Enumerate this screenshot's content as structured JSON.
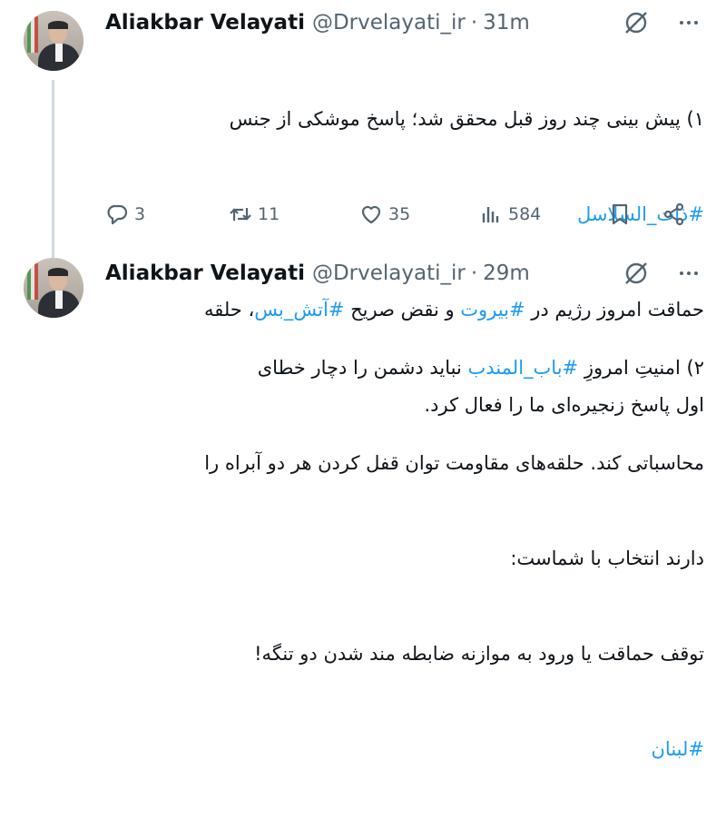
{
  "tweets": [
    {
      "author_name": "Aliakbar Velayati",
      "handle": "@Drvelayati_ir",
      "separator": "·",
      "time": "31m",
      "text": {
        "line1": "۱) پیش بینی چند روز قبل محقق شد؛ پاسخ موشکی از جنس",
        "hashtag1": "#ذات_السلاسل",
        "line3_a": "حماقت امروز رژیم در ",
        "hashtag2": "#بیروت",
        "line3_b": " و نقض صریح ",
        "hashtag3": "#آتش_بس",
        "line3_c": "، حلقه",
        "line4": "اول پاسخ زنجیره‌ای ما را فعال کرد."
      },
      "actions": {
        "replies": "3",
        "reposts": "11",
        "likes": "35",
        "views": "584"
      }
    },
    {
      "author_name": "Aliakbar Velayati",
      "handle": "@Drvelayati_ir",
      "separator": "·",
      "time": "29m",
      "text": {
        "line1_a": "۲) امنیتِ امروزِ ",
        "hashtag1": "#باب_المندب",
        "line1_b": " نباید دشمن را دچار خطای",
        "line2": "محاسباتی کند. حلقه‌های مقاومت توان قفل کردن هر دو آبراه را",
        "line3": "دارند انتخاب با شماست:",
        "line4": "توقف حماقت یا ورود به موازنه ضابطه مند شدن دو تنگه!",
        "hashtag2": "#لبنان"
      }
    }
  ],
  "icons": {
    "reply": "reply-icon",
    "repost": "repost-icon",
    "like": "heart-icon",
    "views": "views-chart-icon",
    "bookmark": "bookmark-icon",
    "share": "share-icon",
    "grok": "grok-icon",
    "more": "more-dots-icon"
  },
  "colors": {
    "link": "#1d9bf0",
    "secondary": "#536471",
    "text": "#0f1419",
    "thread_line": "#cfd9de"
  }
}
